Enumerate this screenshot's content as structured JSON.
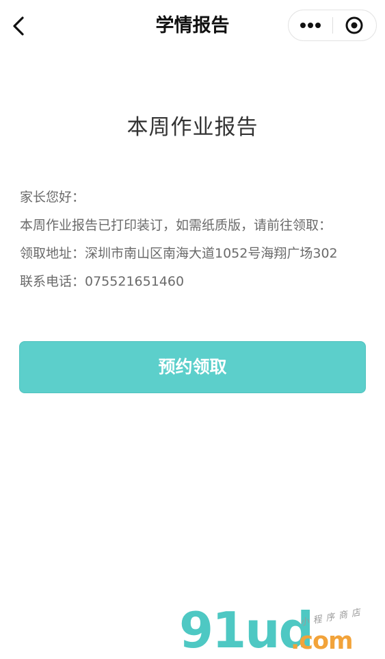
{
  "nav": {
    "title": "学情报告",
    "back_icon": "chevron-left-icon",
    "more_icon": "more-dots-icon",
    "close_icon": "target-circle-icon"
  },
  "report": {
    "title": "本周作业报告",
    "lines": [
      "家长您好：",
      "本周作业报告已打印装订，如需纸质版，请前往领取：",
      "领取地址：深圳市南山区南海大道1052号海翔广场302",
      "联系电话：075521651460"
    ]
  },
  "action": {
    "reserve_label": "预约领取",
    "color": "#5ccfcb"
  },
  "watermark": {
    "main": "91ud",
    "suffix": ".com",
    "tag": "小程序商店"
  }
}
